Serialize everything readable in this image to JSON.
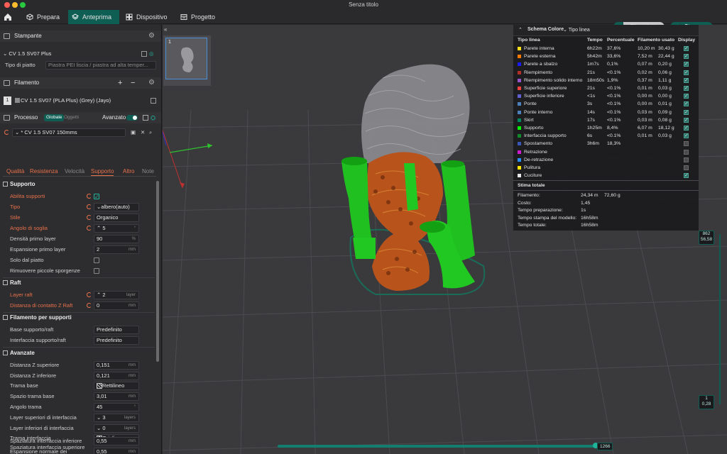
{
  "window": {
    "title": "Senza titolo"
  },
  "tabs": [
    {
      "label": "Prepara"
    },
    {
      "label": "Anteprima"
    },
    {
      "label": "Dispositivo"
    },
    {
      "label": "Progetto"
    }
  ],
  "actions": {
    "slice_label": "Slice piatto",
    "print_label": "Stampa"
  },
  "printer": {
    "section_title": "Stampante",
    "name": "CV 1.5 SV07 Plus",
    "plate_label": "Tipo di piatto",
    "plate_value": "Piastra PEI liscia / piastra ad alta temper..."
  },
  "filament": {
    "section_title": "Filamento",
    "index": "1",
    "name": "CV 1.5 SV07 (PLA Plus) (Grey) (Jayo)"
  },
  "process": {
    "section_title": "Processo",
    "scope_global": "Globale",
    "scope_objects": "Oggetti",
    "advanced_label": "Avanzato",
    "preset": "* CV 1.5 SV07 150mms",
    "subtabs": [
      "Qualità",
      "Resistenza",
      "Velocità",
      "Supporto",
      "Altro",
      "Note"
    ]
  },
  "support": {
    "group_title": "Supporto",
    "enable_label": "Abilita supporti",
    "type_label": "Tipo",
    "type_value": "albero(auto)",
    "style_label": "Stile",
    "style_value": "Organico",
    "threshold_label": "Angolo di soglia",
    "threshold_value": "5",
    "threshold_unit": "°",
    "first_layer_density_label": "Densità primo layer",
    "first_layer_density_value": "90",
    "first_layer_density_unit": "%",
    "first_layer_expansion_label": "Espansione primo layer",
    "first_layer_expansion_value": "2",
    "first_layer_expansion_unit": "mm",
    "build_plate_only_label": "Solo dal piatto",
    "remove_small_label": "Rimuovere piccole sporgenze"
  },
  "raft": {
    "group_title": "Raft",
    "layers_label": "Layer raft",
    "layers_value": "2",
    "layers_unit": "layer",
    "z_contact_label": "Distanza di contatto Z Raft",
    "z_contact_value": "0",
    "z_contact_unit": "mm"
  },
  "support_filament": {
    "group_title": "Filamento per supporti",
    "base_label": "Base supporto/raft",
    "base_value": "Predefinito",
    "interface_label": "Interfaccia supporto/raft",
    "interface_value": "Predefinito"
  },
  "advanced": {
    "group_title": "Avanzate",
    "rows": [
      {
        "label": "Distanza Z superiore",
        "value": "0,151",
        "unit": "mm"
      },
      {
        "label": "Distanza Z inferiore",
        "value": "0,121",
        "unit": "mm"
      },
      {
        "label": "Trama base",
        "value": "Rettilineo",
        "unit": ""
      },
      {
        "label": "Spazio trama base",
        "value": "3,01",
        "unit": "mm"
      },
      {
        "label": "Angolo trama",
        "value": "45",
        "unit": "°"
      },
      {
        "label": "Layer superiori di interfaccia",
        "value": "3",
        "unit": "layers"
      },
      {
        "label": "Layer inferiori di interfaccia",
        "value": "0",
        "unit": "layers"
      },
      {
        "label": "Trama interfaccia",
        "value": "Griglia",
        "unit": ""
      },
      {
        "label": "Spaziatura interfaccia superiore",
        "value": "0,55",
        "unit": "mm"
      },
      {
        "label": "Spaziatura interfaccia inferiore",
        "value": "0,55",
        "unit": "mm"
      },
      {
        "label": "Espansione normale dei",
        "value": "",
        "unit": ""
      }
    ]
  },
  "thumbnail": {
    "index": "1"
  },
  "legend": {
    "title": "Schema Colore",
    "mode": "Tipo linea",
    "headers": [
      "Tipo linea",
      "Tempo",
      "Percentuale",
      "Filamento usato",
      "Display"
    ],
    "rows": [
      {
        "name": "Parete interna",
        "color": "#ffe31a",
        "time": "6h22m",
        "pct": "37,6%",
        "len": "10,20 m",
        "weight": "30,43 g",
        "on": true
      },
      {
        "name": "Parete esterna",
        "color": "#ff7b00",
        "time": "5h42m",
        "pct": "33,6%",
        "len": "7,52 m",
        "weight": "22,44 g",
        "on": true
      },
      {
        "name": "Parete a sbalzo",
        "color": "#1b1bff",
        "time": "1m7s",
        "pct": "0,1%",
        "len": "0,07 m",
        "weight": "0,20 g",
        "on": true
      },
      {
        "name": "Riempimento",
        "color": "#b03029",
        "time": "21s",
        "pct": "<0.1%",
        "len": "0,02 m",
        "weight": "0,06 g",
        "on": true
      },
      {
        "name": "Riempimento solido interno",
        "color": "#9654cc",
        "time": "18m50s",
        "pct": "1,9%",
        "len": "0,37 m",
        "weight": "1,11 g",
        "on": true
      },
      {
        "name": "Superficie superiore",
        "color": "#f04040",
        "time": "21s",
        "pct": "<0.1%",
        "len": "0,01 m",
        "weight": "0,03 g",
        "on": true
      },
      {
        "name": "Superficie inferiore",
        "color": "#6060d0",
        "time": "<1s",
        "pct": "<0.1%",
        "len": "0,00 m",
        "weight": "0,00 g",
        "on": true
      },
      {
        "name": "Ponte",
        "color": "#4d80ba",
        "time": "3s",
        "pct": "<0.1%",
        "len": "0,00 m",
        "weight": "0,01 g",
        "on": true
      },
      {
        "name": "Ponte interno",
        "color": "#4d80ba",
        "time": "14s",
        "pct": "<0.1%",
        "len": "0,03 m",
        "weight": "0,09 g",
        "on": true
      },
      {
        "name": "Skirt",
        "color": "#00875f",
        "time": "17s",
        "pct": "<0.1%",
        "len": "0,03 m",
        "weight": "0,08 g",
        "on": true
      },
      {
        "name": "Supporto",
        "color": "#00ff00",
        "time": "1h25m",
        "pct": "8,4%",
        "len": "6,07 m",
        "weight": "18,12 g",
        "on": true
      },
      {
        "name": "Interfaccia supporto",
        "color": "#128a2b",
        "time": "6s",
        "pct": "<0.1%",
        "len": "0,01 m",
        "weight": "0,03 g",
        "on": true
      },
      {
        "name": "Spostamento",
        "color": "#3856b8",
        "time": "3h6m",
        "pct": "18,3%",
        "len": "",
        "weight": "",
        "on": false
      },
      {
        "name": "Retrazione",
        "color": "#cc1ccc",
        "time": "",
        "pct": "",
        "len": "",
        "weight": "",
        "on": false
      },
      {
        "name": "De-retrazione",
        "color": "#2a90ff",
        "time": "",
        "pct": "",
        "len": "",
        "weight": "",
        "on": false
      },
      {
        "name": "Pulitura",
        "color": "#ffe800",
        "time": "",
        "pct": "",
        "len": "",
        "weight": "",
        "on": false
      },
      {
        "name": "Cuciture",
        "color": "#e8e8e8",
        "time": "",
        "pct": "",
        "len": "",
        "weight": "",
        "on": true
      }
    ],
    "total_title": "Stima totale",
    "totals": [
      {
        "label": "Filamento:",
        "value": "24,34 m",
        "value2": "72,60 g"
      },
      {
        "label": "Costo:",
        "value": "1,45",
        "value2": ""
      },
      {
        "label": "Tempo preparazione:",
        "value": "1s",
        "value2": ""
      },
      {
        "label": "Tempo stampa del modello:",
        "value": "16h58m",
        "value2": ""
      },
      {
        "label": "Tempo totale:",
        "value": "16h58m",
        "value2": ""
      }
    ]
  },
  "layer_slider": {
    "top_max": "862",
    "top_height": "56,58",
    "bottom_min": "1",
    "bottom_height": "0,28"
  },
  "move_slider": {
    "value": "1266"
  },
  "colors": {
    "accent": "#0f5e54",
    "modified": "#e8714a",
    "support": "#00e000",
    "model": "#b8531c"
  }
}
